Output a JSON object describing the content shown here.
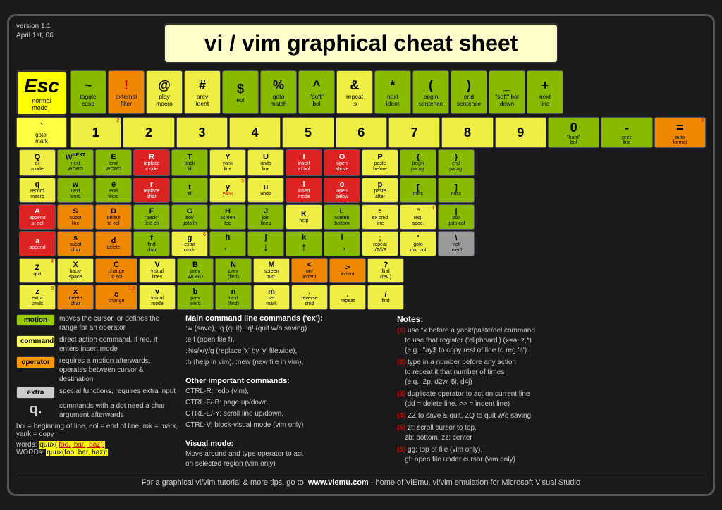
{
  "meta": {
    "version": "version 1.1",
    "date": "April 1st, 06"
  },
  "title": "vi / vim graphical cheat sheet",
  "esc": {
    "key": "Esc",
    "label1": "normal",
    "label2": "mode"
  },
  "footer": {
    "text": "For a graphical vi/vim tutorial & more tips, go to",
    "url": "www.viemu.com",
    "suffix": " - home of ViEmu, vi/vim emulation for Microsoft Visual Studio"
  },
  "legend": {
    "motion": "moves the cursor, or defines the range for an operator",
    "command": "direct action command, if red, it enters insert mode",
    "operator": "requires a motion afterwards, operates between cursor & destination",
    "extra": "special functions, requires extra input",
    "dot_cmd": "commands with a dot need a char argument afterwards"
  },
  "words_line": {
    "words_label": "words:",
    "words_example": "quux(foo, bar, baz);",
    "WORDS_label": "WORDs:",
    "WORDS_example": "quux(foo, bar, baz);"
  },
  "bol_line": "bol = beginning of line, eol = end of line, mk = mark, yank = copy"
}
